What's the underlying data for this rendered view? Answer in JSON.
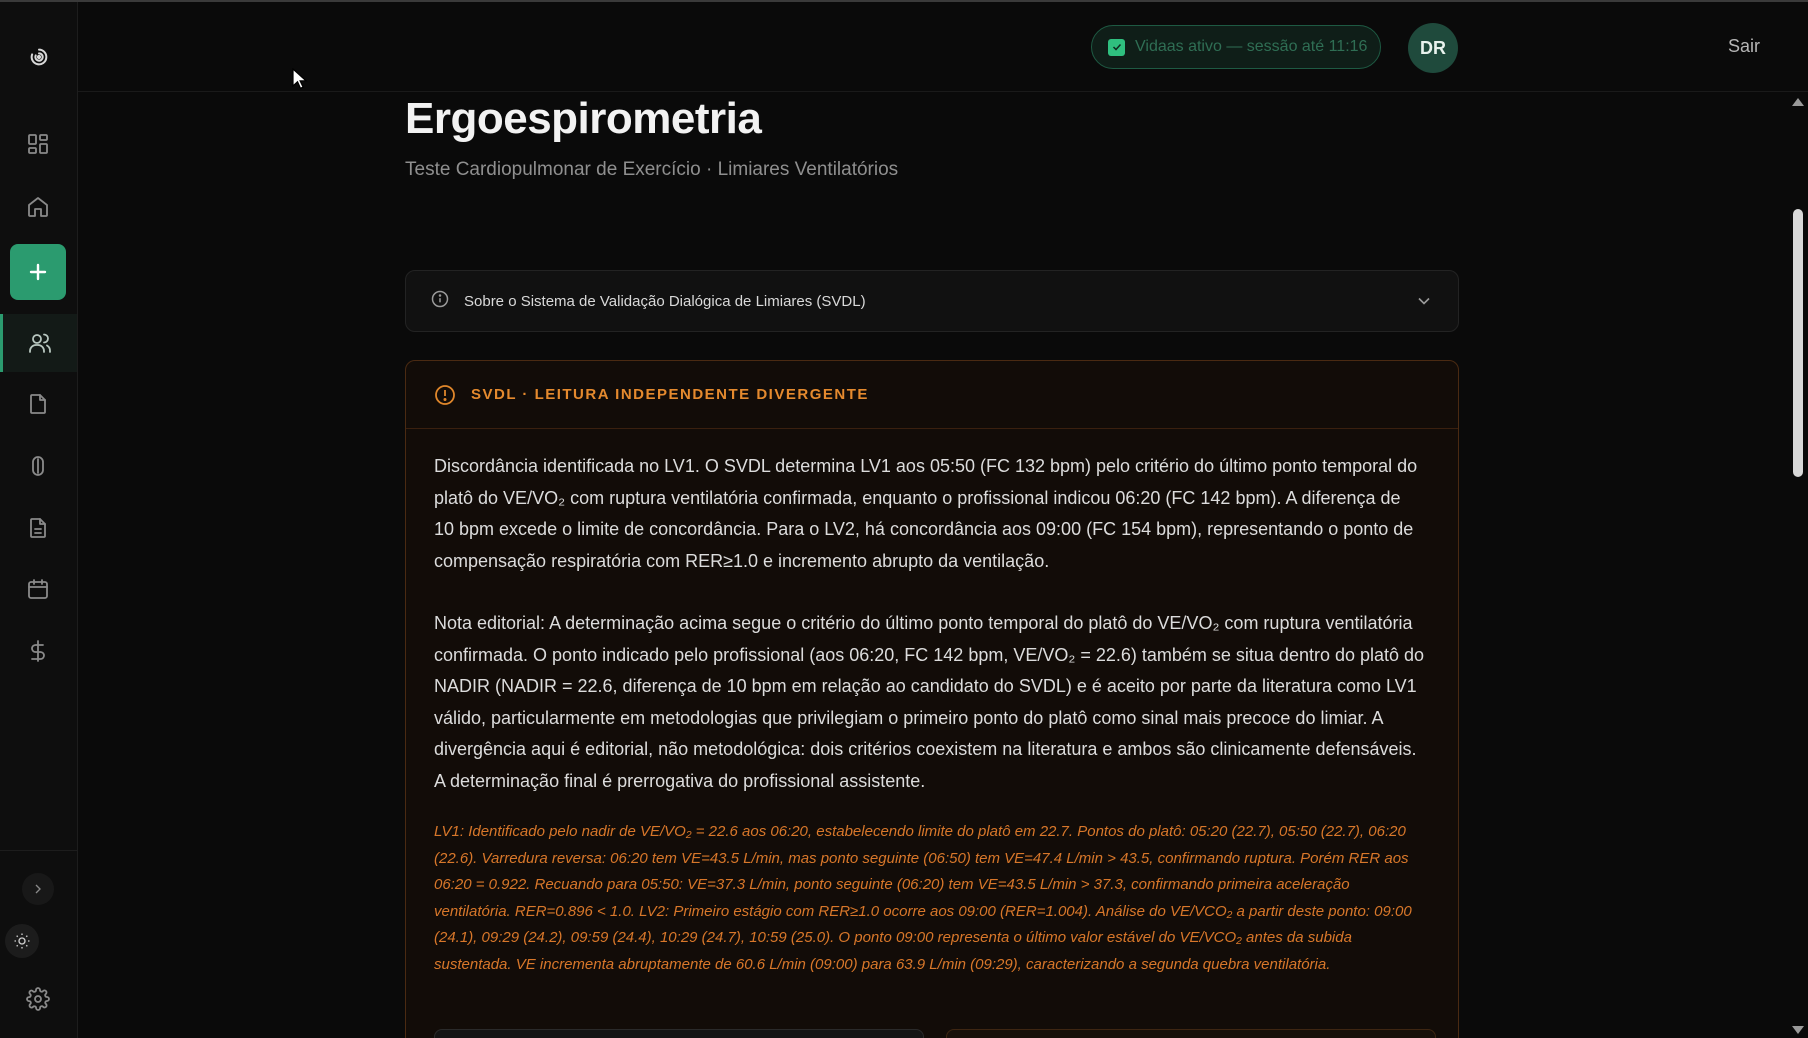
{
  "sidebar": {
    "items": [
      {
        "name": "dashboard",
        "icon": "grid-icon"
      },
      {
        "name": "home",
        "icon": "home-icon"
      },
      {
        "name": "new",
        "icon": "plus-icon"
      },
      {
        "name": "patients",
        "icon": "users-icon"
      },
      {
        "name": "files",
        "icon": "file-icon"
      },
      {
        "name": "capsule",
        "icon": "pill-icon"
      },
      {
        "name": "reports",
        "icon": "document-icon"
      },
      {
        "name": "calendar",
        "icon": "calendar-icon"
      },
      {
        "name": "billing",
        "icon": "dollar-icon"
      }
    ],
    "accent": "#2b9b6f"
  },
  "header": {
    "session_text": "Vidaas ativo — sessão até 11:16",
    "avatar_initials": "DR",
    "logout_label": "Sair"
  },
  "page": {
    "title": "Ergoespirometria",
    "subtitle": "Teste Cardiopulmonar de Exercício · Limiares Ventilatórios"
  },
  "info_panel": {
    "label": "Sobre o Sistema de Validação Dialógica de Limiares (SVDL)"
  },
  "alert": {
    "title": "SVDL · LEITURA INDEPENDENTE DIVERGENTE",
    "accent": "#e58a2e",
    "paragraph_1": "Discordância identificada no LV1. O SVDL determina LV1 aos 05:50 (FC 132 bpm) pelo critério do último ponto temporal do platô do VE/VO₂ com ruptura ventilatória confirmada, enquanto o profissional indicou 06:20 (FC 142 bpm). A diferença de 10 bpm excede o limite de concordância. Para o LV2, há concordância aos 09:00 (FC 154 bpm), representando o ponto de compensação respiratória com RER≥1.0 e incremento abrupto da ventilação.",
    "paragraph_2": "Nota editorial: A determinação acima segue o critério do último ponto temporal do platô do VE/VO₂ com ruptura ventilatória confirmada. O ponto indicado pelo profissional (aos 06:20, FC 142 bpm, VE/VO₂ = 22.6) também se situa dentro do platô do NADIR (NADIR = 22.6, diferença de 10 bpm em relação ao candidato do SVDL) e é aceito por parte da literatura como LV1 válido, particularmente em metodologias que privilegiam o primeiro ponto do platô como sinal mais precoce do limiar. A divergência aqui é editorial, não metodológica: dois critérios coexistem na literatura e ambos são clinicamente defensáveis. A determinação final é prerrogativa do profissional assistente.",
    "analysis": "LV1: Identificado pelo nadir de VE/VO₂ = 22.6 aos 06:20, estabelecendo limite do platô em 22.7. Pontos do platô: 05:20 (22.7), 05:50 (22.7), 06:20 (22.6). Varredura reversa: 06:20 tem VE=43.5 L/min, mas ponto seguinte (06:50) tem VE=47.4 L/min > 43.5, confirmando ruptura. Porém RER aos 06:20 = 0.922. Recuando para 05:50: VE=37.3 L/min, ponto seguinte (06:20) tem VE=43.5 L/min > 37.3, confirmando primeira aceleração ventilatória. RER=0.896 < 1.0. LV2: Primeiro estágio com RER≥1.0 ocorre aos 09:00 (RER=1.004). Análise do VE/VCO₂ a partir deste ponto: 09:00 (24.1), 09:29 (24.2), 09:59 (24.4), 10:29 (24.7), 10:59 (25.0). O ponto 09:00 representa o último valor estável do VE/VCO₂ antes da subida sustentada. VE incrementa abruptamente de 60.6 L/min (09:00) para 63.9 L/min (09:29), caracterizando a segunda quebra ventilatória."
  }
}
